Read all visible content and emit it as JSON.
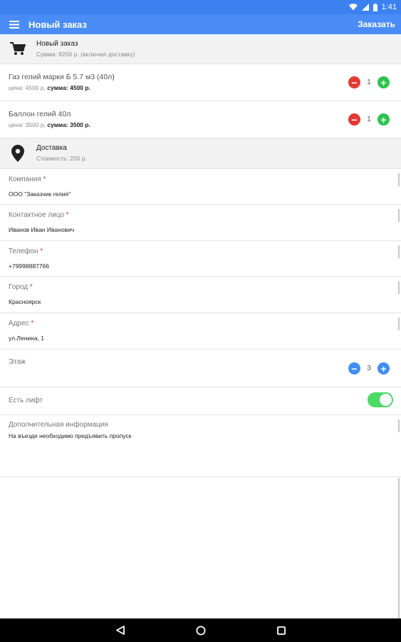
{
  "status": {
    "time": "1:41"
  },
  "appbar": {
    "title": "Новый заказ",
    "action": "Заказать"
  },
  "order": {
    "title": "Новый заказ",
    "sum": "Сумма: 8200 р. (включая доставку)"
  },
  "products": [
    {
      "name": "Газ гелий марки Б 5.7 м3 (40л)",
      "price_label": "цена: 4500 р,",
      "sum_label": "сумма: 4500 р.",
      "qty": "1"
    },
    {
      "name": "Баллон гелий 40л",
      "price_label": "цена: 3500 р,",
      "sum_label": "сумма: 3500 р.",
      "qty": "1"
    }
  ],
  "delivery": {
    "title": "Доставка",
    "cost": "Стоимость: 200 р."
  },
  "fields": {
    "company": {
      "label": "Компания",
      "value": "ООО \"Заказчик гелия\""
    },
    "contact": {
      "label": "Контактное лицо",
      "value": "Иванов Иван Иванович"
    },
    "phone": {
      "label": "Телефон",
      "value": "+79998887766"
    },
    "city": {
      "label": "Город",
      "value": "Красноярск"
    },
    "address": {
      "label": "Адрес",
      "value": "ул.Ленина, 1"
    },
    "floor": {
      "label": "Этаж",
      "value": "3"
    },
    "lift": {
      "label": "Есть лифт",
      "on": true
    },
    "extra": {
      "label": "Дополнительная информация",
      "value": "На въезде необходимо предъявить пропуск"
    }
  },
  "required_mark": "*",
  "icons": [
    "menu-icon",
    "cart-icon",
    "location-pin-icon",
    "minus-icon",
    "plus-icon",
    "back-icon",
    "home-icon",
    "recents-icon",
    "wifi-icon",
    "signal-icon",
    "battery-icon"
  ],
  "colors": {
    "primary": "#4A8CF5",
    "minus": "#E53935",
    "plus": "#2DC44E",
    "stepper_blue": "#3F8EF0",
    "toggle_on": "#4CD964"
  }
}
